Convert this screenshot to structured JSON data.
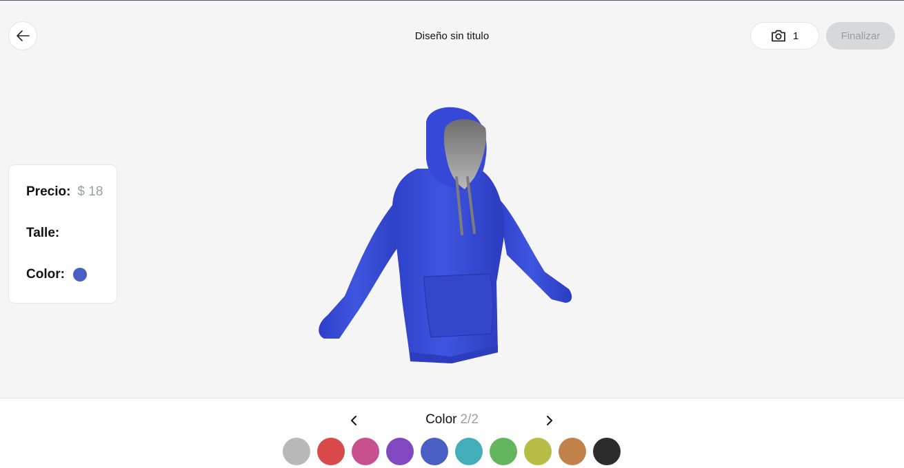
{
  "header": {
    "title": "Diseño sin titulo",
    "photo_count": "1",
    "finish_label": "Finalizar"
  },
  "info": {
    "price_label": "Precio:",
    "price_value": "$ 18",
    "size_label": "Talle:",
    "color_label": "Color:",
    "selected_color": "#4a5fc4"
  },
  "product": {
    "garment_color": "#3a4fd8"
  },
  "picker": {
    "label": "Color",
    "page": "2/2",
    "swatches": [
      {
        "name": "gray",
        "color": "#b8b8b8"
      },
      {
        "name": "red",
        "color": "#d84a4a"
      },
      {
        "name": "pink",
        "color": "#c9508e"
      },
      {
        "name": "purple",
        "color": "#8248c2"
      },
      {
        "name": "blue",
        "color": "#4a5fc4"
      },
      {
        "name": "teal",
        "color": "#45aebb"
      },
      {
        "name": "green",
        "color": "#65b55e"
      },
      {
        "name": "olive",
        "color": "#b7bd44"
      },
      {
        "name": "brown",
        "color": "#c0824a"
      },
      {
        "name": "black",
        "color": "#2c2c2c"
      }
    ]
  },
  "icons": {
    "back": "arrow-left-icon",
    "camera": "camera-icon",
    "prev": "chevron-left-icon",
    "next": "chevron-right-icon"
  }
}
